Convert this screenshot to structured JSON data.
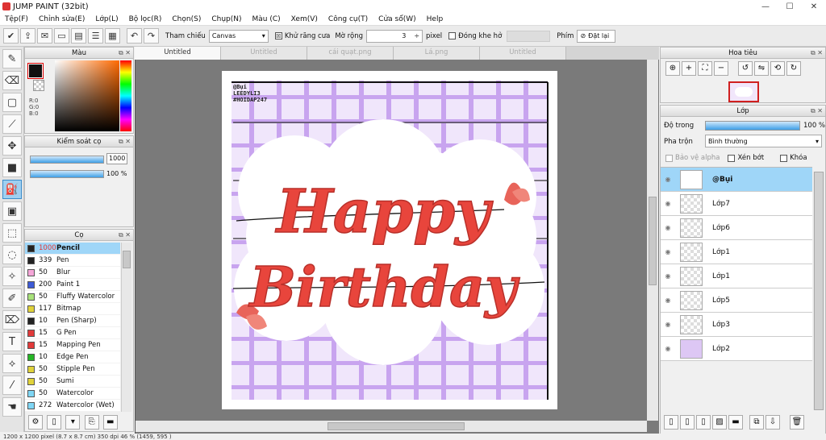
{
  "window": {
    "title": "JUMP PAINT (32bit)",
    "minimize": "—",
    "maximize": "☐",
    "close": "✕"
  },
  "menu": [
    "Tệp(F)",
    "Chỉnh sửa(E)",
    "Lớp(L)",
    "Bộ lọc(R)",
    "Chọn(S)",
    "Chụp(N)",
    "Màu (C)",
    "Xem(V)",
    "Công cụ(T)",
    "Cửa sổ(W)",
    "Help"
  ],
  "toolbar": {
    "reference_label": "Tham chiếu",
    "reference_value": "Canvas",
    "antialias_label": "Khử răng cưa",
    "antialias_checked": "☒",
    "blur_label": "Mờ rộng",
    "blur_value": "3",
    "blur_unit": "pixel",
    "close_gap_label": "Đóng khe hở",
    "key_label": "Phím",
    "reset_label": "Đặt lại"
  },
  "color_panel": {
    "title": "Màu",
    "r": "R:0",
    "g": "G:0",
    "b": "B:0"
  },
  "brush_control": {
    "title": "Kiểm soát cọ",
    "size": "1000",
    "opacity": "100 %"
  },
  "brush_panel": {
    "title": "Cọ",
    "items": [
      {
        "size": "1000",
        "name": "Pencil",
        "color": "#222222"
      },
      {
        "size": "339",
        "name": "Pen",
        "color": "#222222"
      },
      {
        "size": "50",
        "name": "Blur",
        "color": "#f5a6d8"
      },
      {
        "size": "200",
        "name": "Paint 1",
        "color": "#3d5bd6"
      },
      {
        "size": "50",
        "name": "Fluffy Watercolor",
        "color": "#a8e27a"
      },
      {
        "size": "117",
        "name": "Bitmap",
        "color": "#e0d23a"
      },
      {
        "size": "10",
        "name": "Pen (Sharp)",
        "color": "#222222"
      },
      {
        "size": "15",
        "name": "G Pen",
        "color": "#e23a3a"
      },
      {
        "size": "15",
        "name": "Mapping Pen",
        "color": "#e23a3a"
      },
      {
        "size": "10",
        "name": "Edge Pen",
        "color": "#26b526"
      },
      {
        "size": "50",
        "name": "Stipple Pen",
        "color": "#e0d23a"
      },
      {
        "size": "50",
        "name": "Sumi",
        "color": "#e0d23a"
      },
      {
        "size": "50",
        "name": "Watercolor",
        "color": "#7fd6f5"
      },
      {
        "size": "272",
        "name": "Watercolor (Wet)",
        "color": "#7fd6f5"
      }
    ]
  },
  "tabs": [
    "Untitled",
    "Untitled",
    "cái quạt.png",
    "Lá.png",
    "Untitled"
  ],
  "canvas_text": {
    "watermark": [
      "@Bụi",
      "LEEDYLI3",
      "#HOIDAP247"
    ],
    "word1": "Happy",
    "word2": "Birthday"
  },
  "navigator": {
    "title": "Hoa tiêu"
  },
  "layers": {
    "title": "Lớp",
    "opacity_label": "Độ trong",
    "opacity_value": "100 %",
    "blend_label": "Pha trộn",
    "blend_value": "Bình thường",
    "protect_alpha": "Bảo vệ alpha",
    "clipping": "Xén bớt",
    "lock": "Khóa",
    "items": [
      "@Bụi",
      "Lớp7",
      "Lớp6",
      "Lớp1",
      "Lớp1",
      "Lớp5",
      "Lớp3",
      "Lớp2"
    ]
  },
  "status": "1200 x 1200 pixel  (8.7 x 8.7 cm)  350 dpi  46 %  (1459, 595 )",
  "colors": {
    "accent": "#3e9fe6",
    "selected_row": "#9fd6f8",
    "grid_purple": "#b98ae8",
    "lettering_red": "#e8453c"
  }
}
